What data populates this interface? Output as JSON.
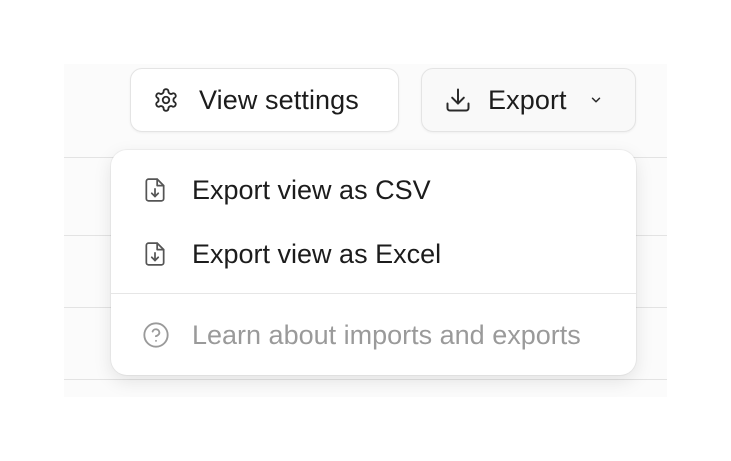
{
  "toolbar": {
    "view_settings_label": "View settings",
    "view_settings_icon": "gear-icon",
    "export_label": "Export",
    "export_icon": "download-icon",
    "export_chevron_icon": "chevron-down-icon"
  },
  "export_menu": {
    "items": [
      {
        "label": "Export view as CSV",
        "icon": "file-download-icon"
      },
      {
        "label": "Export view as Excel",
        "icon": "file-download-icon"
      }
    ],
    "help_item": {
      "label": "Learn about imports and exports",
      "icon": "help-circle-icon"
    }
  },
  "colors": {
    "text": "#1c1c1c",
    "muted_text": "#9a9a9a",
    "border": "#e4e4e4",
    "divider": "#e6e6e6"
  }
}
